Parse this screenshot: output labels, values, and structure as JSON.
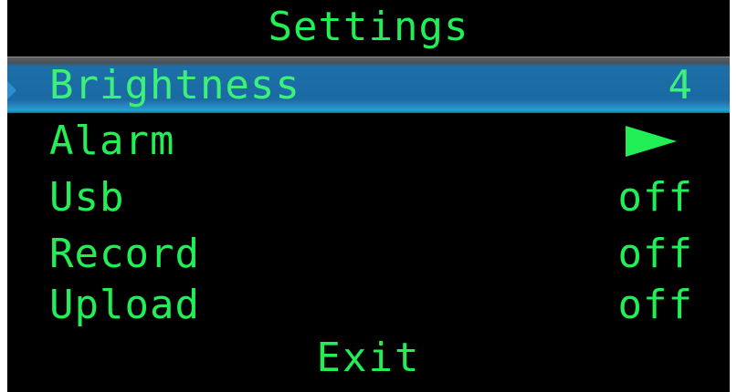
{
  "screen": {
    "title": "Settings"
  },
  "menu": {
    "brightness": {
      "label": "Brightness",
      "value": "4"
    },
    "alarm": {
      "label": "Alarm",
      "icon": "play-arrow-icon"
    },
    "usb": {
      "label": "Usb",
      "value": "off"
    },
    "record": {
      "label": "Record",
      "value": "off"
    },
    "upload": {
      "label": "Upload",
      "value": "off"
    },
    "exit": {
      "label": "Exit"
    }
  },
  "colors": {
    "text": "#22ee55",
    "background": "#000000",
    "selection": "#1a6aa4"
  }
}
